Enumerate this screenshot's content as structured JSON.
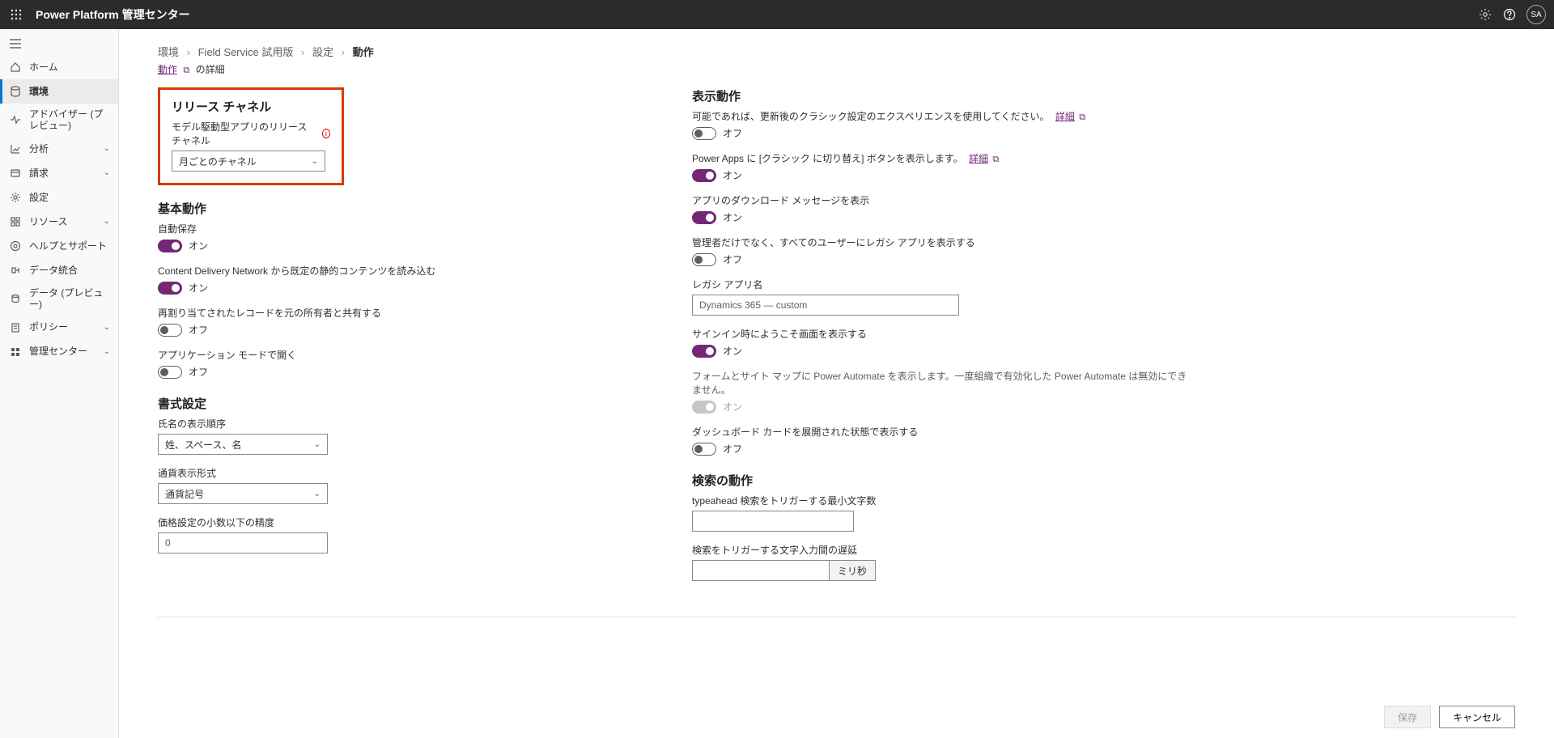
{
  "header": {
    "title": "Power Platform 管理センター",
    "avatar": "SA"
  },
  "sidebar": {
    "items": [
      {
        "id": "home",
        "label": "ホーム",
        "icon": "home",
        "chev": false
      },
      {
        "id": "env",
        "label": "環境",
        "icon": "env",
        "chev": false,
        "active": true
      },
      {
        "id": "advisor",
        "label": "アドバイザー (プレビュー)",
        "icon": "pulse",
        "chev": false
      },
      {
        "id": "analytics",
        "label": "分析",
        "icon": "chart",
        "chev": true
      },
      {
        "id": "billing",
        "label": "請求",
        "icon": "bill",
        "chev": true
      },
      {
        "id": "settings",
        "label": "設定",
        "icon": "gear",
        "chev": false
      },
      {
        "id": "resources",
        "label": "リソース",
        "icon": "res",
        "chev": true
      },
      {
        "id": "help",
        "label": "ヘルプとサポート",
        "icon": "help",
        "chev": false
      },
      {
        "id": "dataint",
        "label": "データ統合",
        "icon": "dataint",
        "chev": false
      },
      {
        "id": "datapreview",
        "label": "データ (プレビュー)",
        "icon": "datap",
        "chev": false
      },
      {
        "id": "policy",
        "label": "ポリシー",
        "icon": "policy",
        "chev": true
      },
      {
        "id": "admincenter",
        "label": "管理センター",
        "icon": "admin",
        "chev": true
      }
    ]
  },
  "breadcrumb": {
    "items": [
      "環境",
      "Field Service 試用版",
      "設定"
    ],
    "current": "動作"
  },
  "sublink": {
    "link": "動作",
    "suffix": "の詳細"
  },
  "left": {
    "release": {
      "title": "リリース チャネル",
      "label": "モデル駆動型アプリのリリース チャネル",
      "value": "月ごとのチャネル"
    },
    "basic": {
      "title": "基本動作",
      "autosave": {
        "label": "自動保存",
        "state": "オン"
      },
      "cdn": {
        "label": "Content Delivery Network から既定の静的コンテンツを読み込む",
        "state": "オン"
      },
      "reassign": {
        "label": "再割り当てされたレコードを元の所有者と共有する",
        "state": "オフ"
      },
      "appmode": {
        "label": "アプリケーション モードで開く",
        "state": "オフ"
      }
    },
    "format": {
      "title": "書式設定",
      "nameorder": {
        "label": "氏名の表示順序",
        "value": "姓、スペース、名"
      },
      "currency": {
        "label": "通貨表示形式",
        "value": "通貨記号"
      },
      "precision": {
        "label": "価格設定の小数以下の精度",
        "value": "0"
      }
    }
  },
  "right": {
    "display": {
      "title": "表示動作",
      "classic": {
        "desc": "可能であれば、更新後のクラシック設定のエクスペリエンスを使用してください。",
        "link": "詳細",
        "state": "オフ"
      },
      "switchclassic": {
        "desc": "Power Apps に [クラシック に切り替え] ボタンを表示します。",
        "link": "詳細",
        "state": "オン"
      },
      "download": {
        "desc": "アプリのダウンロード メッセージを表示",
        "state": "オン"
      },
      "legacy": {
        "desc": "管理者だけでなく、すべてのユーザーにレガシ アプリを表示する",
        "state": "オフ"
      },
      "legacyname": {
        "label": "レガシ アプリ名",
        "value": "Dynamics 365 — custom"
      },
      "welcome": {
        "desc": "サインイン時にようこそ画面を表示する",
        "state": "オン"
      },
      "automate": {
        "desc": "フォームとサイト マップに Power Automate を表示します。一度組織で有効化した Power Automate は無効にできません。",
        "state": "オン"
      },
      "dashboard": {
        "desc": "ダッシュボード カードを展開された状態で表示する",
        "state": "オフ"
      }
    },
    "search": {
      "title": "検索の動作",
      "typeahead": {
        "label": "typeahead 検索をトリガーする最小文字数"
      },
      "delay": {
        "label": "検索をトリガーする文字入力間の遅延",
        "suffix": "ミリ秒"
      }
    }
  },
  "footer": {
    "save": "保存",
    "cancel": "キャンセル"
  }
}
